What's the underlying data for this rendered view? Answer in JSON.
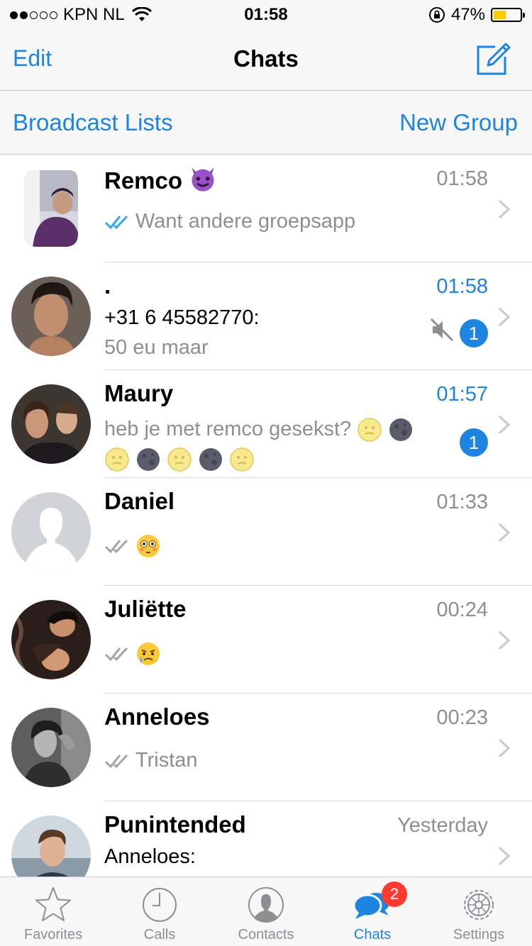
{
  "status_bar": {
    "carrier": "KPN NL",
    "time": "01:58",
    "battery": "47%",
    "battery_level": 0.47,
    "signal_filled": 2,
    "signal_total": 5
  },
  "nav": {
    "edit": "Edit",
    "title": "Chats",
    "compose_icon": "compose-icon"
  },
  "sub_bar": {
    "broadcast": "Broadcast Lists",
    "new_group": "New Group"
  },
  "chats": [
    {
      "name": "Remco",
      "name_emoji": "devil-emoji",
      "time": "01:58",
      "preview": "Want andere groepsapp",
      "ticks": "read"
    },
    {
      "name": ".",
      "time": "01:58",
      "sender": "+31 6 45582770:",
      "preview": "50 eu maar",
      "muted": true,
      "unread": "1"
    },
    {
      "name": "Maury",
      "time": "01:57",
      "preview": "heb je met remco gesekst?",
      "unread": "1"
    },
    {
      "name": "Daniel",
      "time": "01:33",
      "ticks": "delivered",
      "preview_emoji": "flushed-emoji"
    },
    {
      "name": "Juliëtte",
      "time": "00:24",
      "ticks": "delivered",
      "preview_emoji": "sad-emoji"
    },
    {
      "name": "Anneloes",
      "time": "00:23",
      "preview": "Tristan",
      "ticks": "delivered"
    },
    {
      "name": "Punintended",
      "time": "Yesterday",
      "sender": "Anneloes:",
      "muted": true
    }
  ],
  "tabs": [
    {
      "label": "Favorites",
      "icon": "star-icon"
    },
    {
      "label": "Calls",
      "icon": "clock-icon"
    },
    {
      "label": "Contacts",
      "icon": "person-icon"
    },
    {
      "label": "Chats",
      "icon": "chat-bubbles-icon",
      "badge": "2",
      "active": true
    },
    {
      "label": "Settings",
      "icon": "gear-icon"
    }
  ],
  "colors": {
    "accent": "#1d84e0",
    "badge_red": "#ff3b30",
    "battery_yellow": "#ffcc00"
  }
}
